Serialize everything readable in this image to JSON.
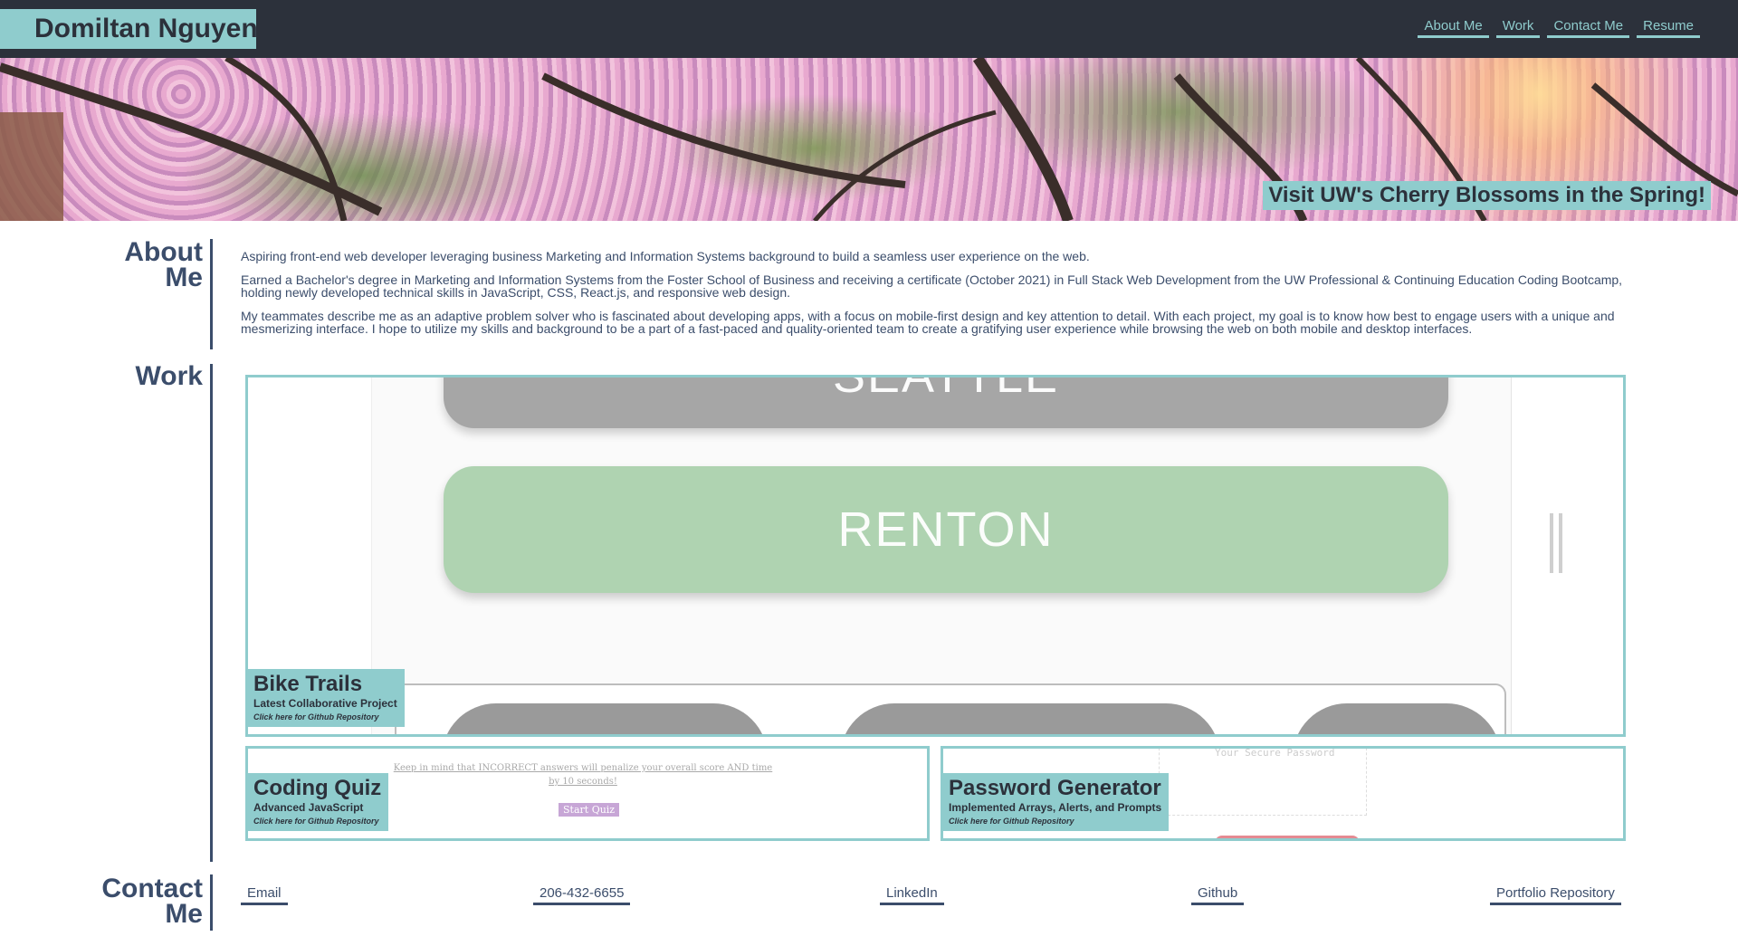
{
  "header": {
    "brand": "Domiltan Nguyen",
    "nav": [
      "About Me",
      "Work",
      "Contact Me",
      "Resume"
    ]
  },
  "hero": {
    "caption": "Visit UW's Cherry Blossoms in the Spring!"
  },
  "about": {
    "title_line1": "About",
    "title_line2": "Me",
    "paragraphs": [
      "Aspiring front-end web developer leveraging business Marketing and Information Systems background to build a seamless user experience on the web.",
      "Earned a Bachelor's degree in Marketing and Information Systems from the Foster School of Business and receiving a certificate (October 2021) in Full Stack Web Development from the UW Professional & Continuing Education Coding Bootcamp, holding newly developed technical skills in JavaScript, CSS, React.js, and responsive web design.",
      "My teammates describe me as an adaptive problem solver who is fascinated about developing apps, with a focus on mobile-first design and key attention to detail. With each project, my goal is to know how best to engage users with a unique and mesmerizing interface. I hope to utilize my skills and background to be a part of a fast-paced and quality-oriented team to create a gratifying user experience while browsing the web on both mobile and desktop interfaces."
    ]
  },
  "work": {
    "title": "Work",
    "projects": [
      {
        "title": "Bike Trails",
        "subtitle": "Latest Collaborative Project",
        "link": "Click here for Github Repository",
        "preview": {
          "top_button": "SEATTLE",
          "main_button": "RENTON"
        }
      },
      {
        "title": "Coding Quiz",
        "subtitle": "Advanced JavaScript",
        "link": "Click here for Github Repository",
        "preview": {
          "note": "Keep in mind that INCORRECT answers will penalize your overall score AND time by 10 seconds!",
          "button": "Start Quiz"
        }
      },
      {
        "title": "Password Generator",
        "subtitle": "Implemented Arrays, Alerts, and Prompts",
        "link": "Click here for Github Repository",
        "preview": {
          "placeholder": "Your Secure Password"
        }
      }
    ]
  },
  "contact": {
    "title_line1": "Contact",
    "title_line2": "Me",
    "links": [
      "Email",
      "206-432-6655",
      "LinkedIn",
      "Github",
      "Portfolio Repository"
    ]
  },
  "colors": {
    "header_bg": "#2c313b",
    "accent": "#8fcccd",
    "text": "#3b4d6b",
    "renton_green": "#afd3b1"
  }
}
